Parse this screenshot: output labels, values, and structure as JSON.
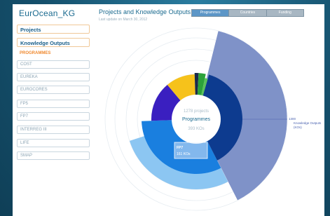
{
  "app": {
    "title": "EurOcean_KG"
  },
  "nav": {
    "projects_label": "Projects",
    "knowledge_label": "Knowledge Outputs",
    "programmes_heading": "PROGRAMMES"
  },
  "programmes": [
    "COST",
    "EUREKA",
    "EUROCORES",
    "FP5",
    "FP7",
    "INTERREG III",
    "LIFE",
    "SMAP"
  ],
  "chart_header": {
    "title": "Projects and Knowledge Outputs by",
    "update": "Last update on March 30, 2012"
  },
  "tabs": [
    "Programmes",
    "Countries",
    "Funding"
  ],
  "active_tab": "Programmes",
  "center": {
    "projects": "1278 projects",
    "label": "Programmes",
    "kos": "393 KOs"
  },
  "tooltip": {
    "title": "FP7",
    "value": "161 KOs"
  },
  "callout": {
    "value": "1300",
    "label": "Knowledge Outputs",
    "sub": "(KOs)"
  },
  "colors": {
    "accent": "#1a6a8f",
    "orange": "#f08a30",
    "ko_slice": "#7f92c8",
    "fp7": "#1a7fdf",
    "fp7_light": "#8cc6f2",
    "navy": "#0d3b8f",
    "purple": "#3a1fc0",
    "yellow": "#f6c21b",
    "green": "#2ca23a"
  }
}
